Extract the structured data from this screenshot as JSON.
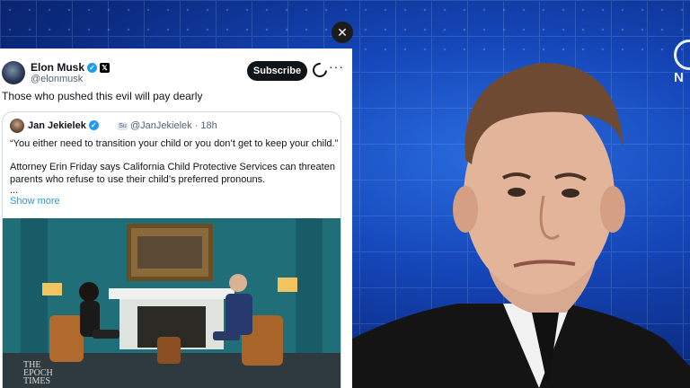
{
  "overlay": {
    "close_glyph": "✕",
    "logo_letter": "N"
  },
  "tweet": {
    "author": {
      "name": "Elon Musk",
      "handle": "@elonmusk",
      "verified_glyph": "✓",
      "x_badge": "𝕏"
    },
    "subscribe_label": "Subscribe",
    "more_glyph": "···",
    "text": "Those who pushed this evil will pay dearly",
    "quote": {
      "author": {
        "name": "Jan Jekielek",
        "sub_badge": "Su",
        "handle_time": "@JanJekielek · 18h"
      },
      "lines": [
        "“You either need to transition your child or you don’t get to keep your child.”",
        "Attorney Erin Friday says California Child Protective Services can threaten",
        "parents who refuse to use their child’s preferred pronouns.",
        "..."
      ],
      "show_more": "Show more"
    },
    "video": {
      "watermark": [
        "THE",
        "EPOCH",
        "TIMES"
      ]
    }
  },
  "colors": {
    "accent": "#1d9bf0",
    "background_blue": "#1446b8",
    "subscribe_bg": "#0f1419"
  },
  "icons": [
    "close-icon",
    "verified-icon",
    "x-logo-icon",
    "grok-icon",
    "more-icon",
    "network-logo-icon"
  ]
}
